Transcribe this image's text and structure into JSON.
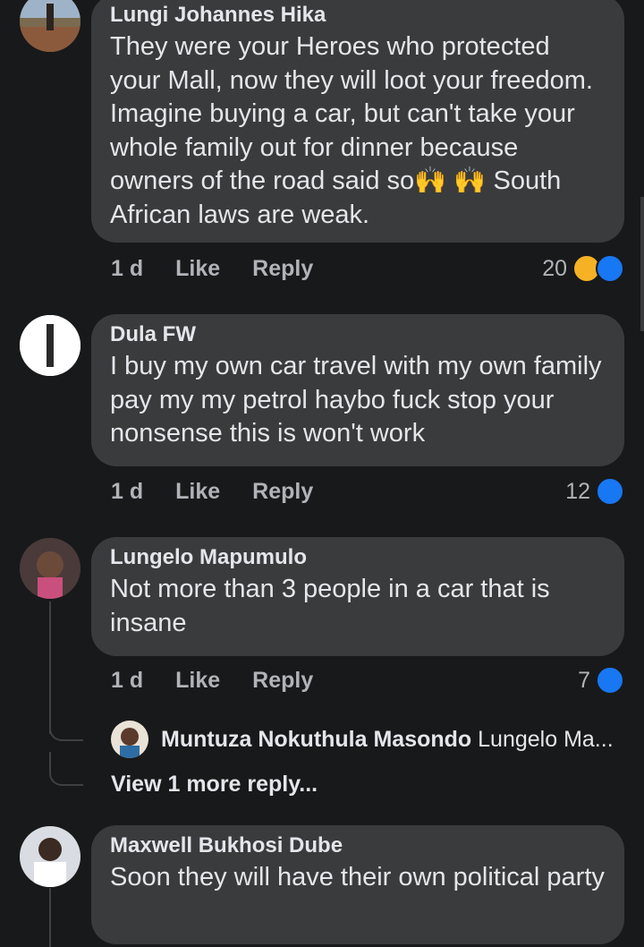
{
  "comments": [
    {
      "author": "Lungi Johannes Hika",
      "text": "They were your Heroes who protected your Mall, now they will loot your freedom. Imagine buying a car, but can't take your whole family out for dinner because owners of the road said so🙌 🙌 South African laws are weak.",
      "time": "1 d",
      "like_label": "Like",
      "reply_label": "Reply",
      "reaction_count": "20",
      "reactions": [
        "haha-icon",
        "like-icon"
      ]
    },
    {
      "author": "Dula FW",
      "text": "I buy my own car travel with my own family  pay my my petrol haybo fuck stop your nonsense this is won't work",
      "time": "1 d",
      "like_label": "Like",
      "reply_label": "Reply",
      "reaction_count": "12",
      "reactions": [
        "like-icon"
      ]
    },
    {
      "author": "Lungelo Mapumulo",
      "text": "Not more than 3 people in a car that is insane",
      "time": "1 d",
      "like_label": "Like",
      "reply_label": "Reply",
      "reaction_count": "7",
      "reactions": [
        "like-icon"
      ]
    },
    {
      "author": "Maxwell Bukhosi Dube",
      "text": "Soon they will have their own political party"
    }
  ],
  "reply_preview": {
    "author": "Muntuza Nokuthula Masondo",
    "text": "Lungelo Ma..."
  },
  "view_more_label": "View 1 more reply...",
  "colors": {
    "background": "#18191a",
    "bubble": "#3a3b3c",
    "like_blue": "#1877f2",
    "haha_yellow": "#f7b125"
  }
}
